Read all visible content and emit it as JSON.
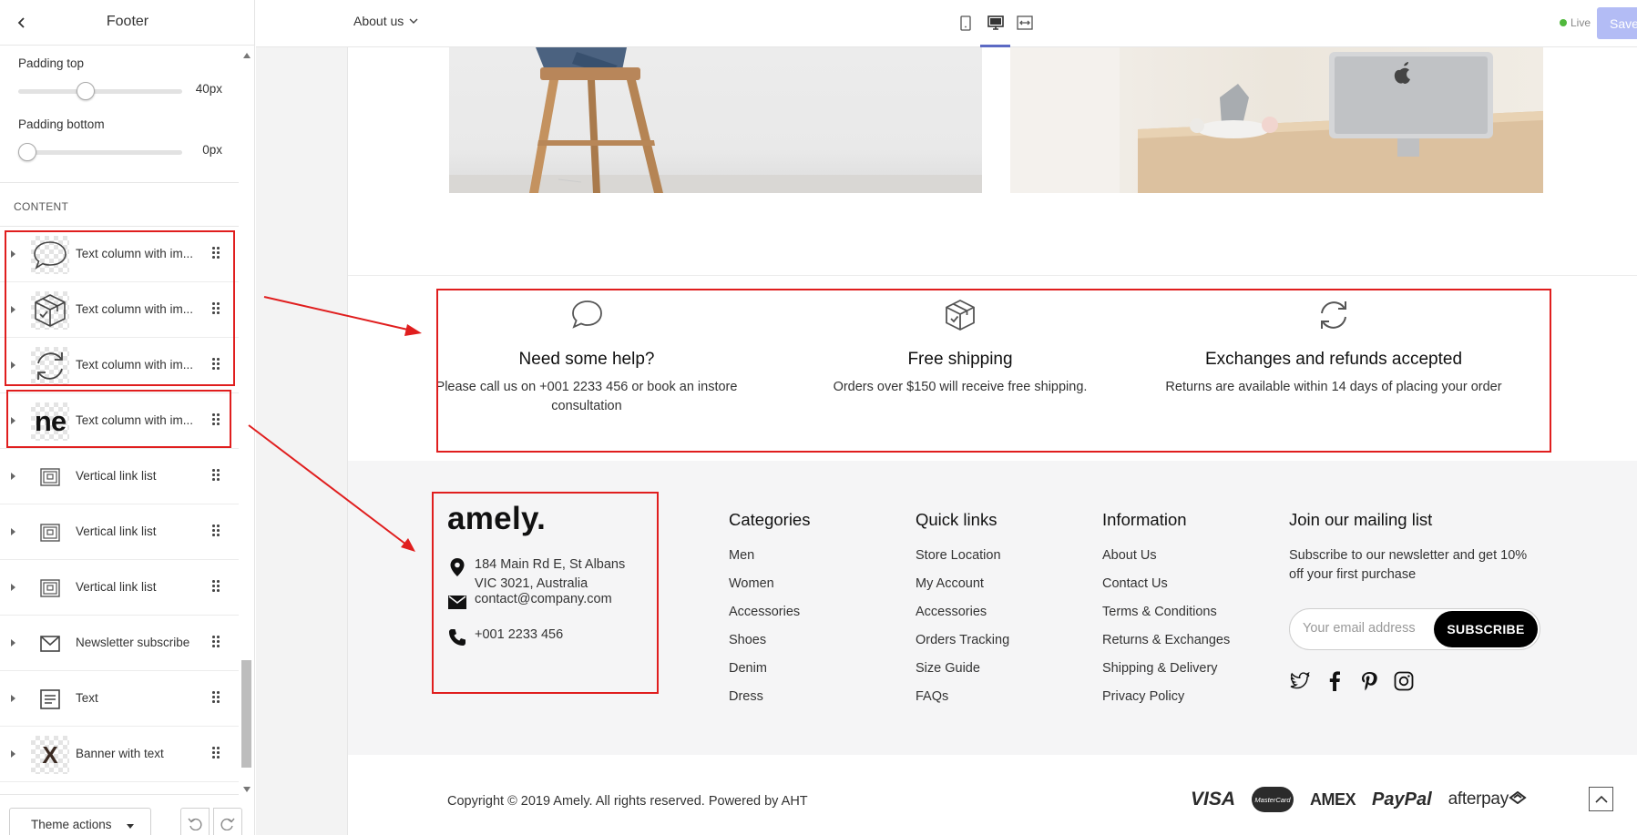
{
  "sidebar": {
    "title": "Footer",
    "settings": [
      {
        "label": "Padding top",
        "value": "40px",
        "level": 0.4
      },
      {
        "label": "Padding bottom",
        "value": "0px",
        "level": 0
      }
    ],
    "content_title": "CONTENT",
    "blocks": [
      {
        "label": "Text column with im...",
        "thumb": "speech-bubble-icon"
      },
      {
        "label": "Text column with im...",
        "thumb": "package-box-icon"
      },
      {
        "label": "Text column with im...",
        "thumb": "refresh-arrows-icon"
      },
      {
        "label": "Text column with im...",
        "thumb": "text-image-thumbnail",
        "thumb_text": "ne"
      },
      {
        "label": "Vertical link list",
        "thumb": "link-list-icon"
      },
      {
        "label": "Vertical link list",
        "thumb": "link-list-icon"
      },
      {
        "label": "Vertical link list",
        "thumb": "link-list-icon"
      },
      {
        "label": "Newsletter subscribe",
        "thumb": "envelope-icon"
      },
      {
        "label": "Text",
        "thumb": "text-lines-icon"
      },
      {
        "label": "Banner with text",
        "thumb": "image-thumbnail",
        "thumb_text": "X"
      }
    ],
    "theme_actions_label": "Theme actions"
  },
  "topbar": {
    "page_select": "About us",
    "live_label": "Live",
    "save_label": "Save"
  },
  "features": [
    {
      "title": "Need some help?",
      "text": "Please call us on +001 2233 456 or book an instore consultation",
      "icon": "speech-bubble-icon"
    },
    {
      "title": "Free shipping",
      "text": "Orders over $150 will receive free shipping.",
      "icon": "package-box-icon"
    },
    {
      "title": "Exchanges and refunds accepted",
      "text": "Returns are available within 14 days of placing your order",
      "icon": "refresh-arrows-icon"
    }
  ],
  "footer": {
    "logo": "amely.",
    "address_line1": "184 Main Rd E, St Albans",
    "address_line2": "VIC 3021, Australia",
    "email": "contact@company.com",
    "phone": "+001 2233 456",
    "columns": [
      {
        "title": "Categories",
        "links": [
          "Men",
          "Women",
          "Accessories",
          "Shoes",
          "Denim",
          "Dress"
        ]
      },
      {
        "title": "Quick links",
        "links": [
          "Store Location",
          "My Account",
          "Accessories",
          "Orders Tracking",
          "Size Guide",
          "FAQs"
        ]
      },
      {
        "title": "Information",
        "links": [
          "About Us",
          "Contact Us",
          "Terms & Conditions",
          "Returns & Exchanges",
          "Shipping & Delivery",
          "Privacy Policy"
        ]
      }
    ],
    "mailing": {
      "title": "Join our mailing list",
      "description": "Subscribe to our newsletter and get 10% off your first purchase",
      "placeholder": "Your email address",
      "button": "SUBSCRIBE"
    },
    "social_icons": [
      "twitter-icon",
      "facebook-icon",
      "pinterest-icon",
      "instagram-icon"
    ],
    "copyright": "Copyright © 2019 Amely. All rights reserved. Powered by AHT",
    "payments": {
      "visa": "VISA",
      "mastercard": "MasterCard",
      "amex": "AMEX",
      "paypal": "PayPal",
      "afterpay": "afterpay"
    }
  },
  "colors": {
    "annotation": "#e01e1e",
    "save_button": "#b3bcf5",
    "live": "#50b83c",
    "accent": "#5c6ac4"
  }
}
